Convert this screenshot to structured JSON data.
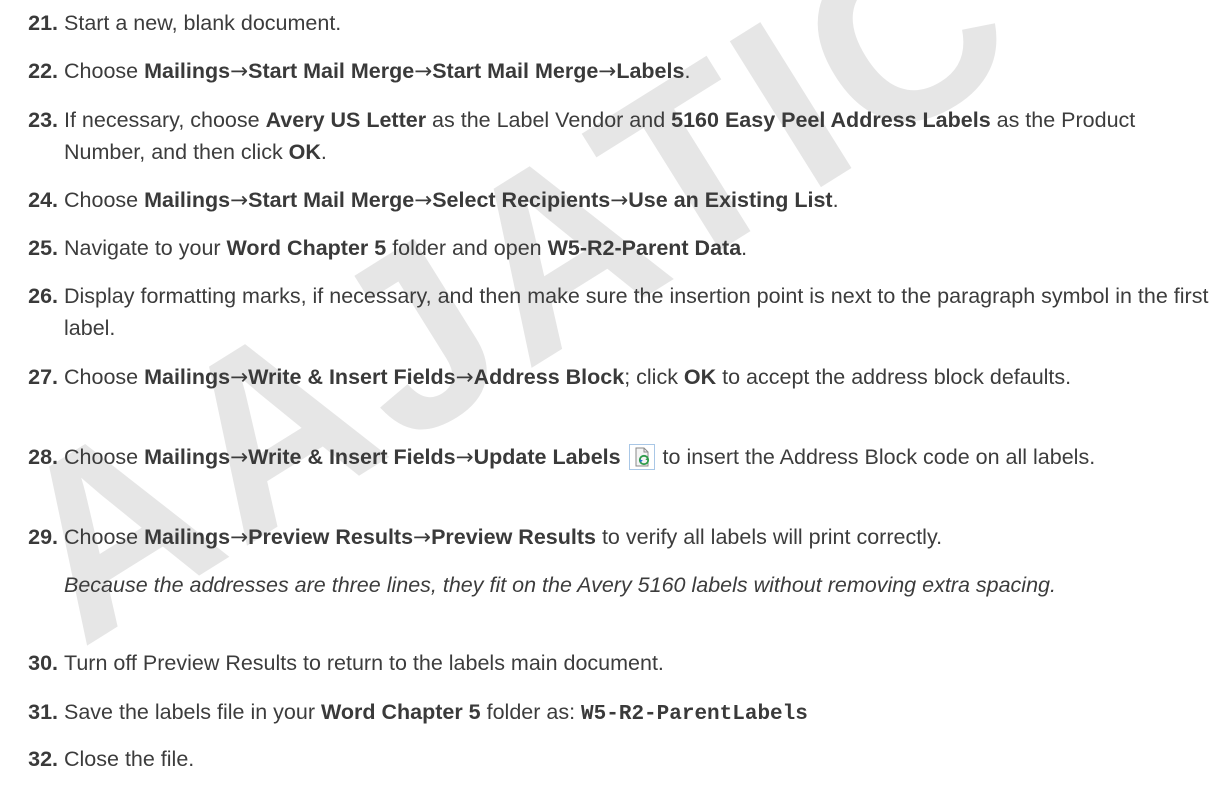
{
  "watermark": "AAJATIC",
  "steps": [
    {
      "num": "21.",
      "parts": [
        "Start a new, blank document."
      ]
    },
    {
      "num": "22.",
      "parts": [
        "Choose ",
        "Mailings",
        "→",
        "Start Mail Merge",
        "→",
        "Start Mail Merge",
        "→",
        "Labels",
        "."
      ]
    },
    {
      "num": "23.",
      "parts": [
        "If necessary, choose ",
        "Avery US Letter",
        " as the Label Vendor and ",
        "5160 Easy Peel Address Labels",
        " as the Product Number, and then click ",
        "OK",
        "."
      ]
    },
    {
      "num": "24.",
      "parts": [
        "Choose ",
        "Mailings",
        "→",
        "Start Mail Merge",
        "→",
        "Select Recipients",
        "→",
        "Use an Existing List",
        "."
      ]
    },
    {
      "num": "25.",
      "parts": [
        "Navigate to your ",
        "Word Chapter 5",
        " folder and open ",
        "W5-R2-Parent Data",
        "."
      ]
    },
    {
      "num": "26.",
      "parts": [
        "Display formatting marks, if necessary, and then make sure the insertion point is next to the paragraph symbol in the first label."
      ]
    },
    {
      "num": "27.",
      "parts": [
        "Choose ",
        "Mailings",
        "→",
        "Write & Insert Fields",
        "→",
        "Address Block",
        "; click ",
        "OK",
        " to accept the address block defaults."
      ]
    },
    {
      "num": "28.",
      "parts": [
        "Choose ",
        "Mailings",
        "→",
        "Write & Insert Fields",
        "→",
        "Update Labels",
        " to insert the Address Block code on all labels."
      ]
    },
    {
      "num": "29.",
      "parts": [
        "Choose ",
        "Mailings",
        "→",
        "Preview Results",
        "→",
        "Preview Results",
        " to verify all labels will print correctly."
      ],
      "note": "Because the addresses are three lines, they fit on the Avery 5160 labels without removing extra spacing."
    },
    {
      "num": "30.",
      "parts": [
        "Turn off Preview Results to return to the labels main document."
      ]
    },
    {
      "num": "31.",
      "parts": [
        "Save the labels file in your ",
        "Word Chapter 5",
        " folder as: ",
        "W5-R2-ParentLabels"
      ]
    },
    {
      "num": "32.",
      "parts": [
        "Close the file."
      ]
    }
  ],
  "icons": {
    "update_labels": "update-labels-icon"
  }
}
